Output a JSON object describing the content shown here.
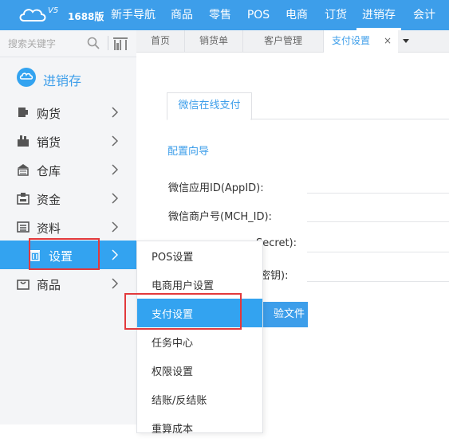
{
  "topbar": {
    "logo_superscript": "V5",
    "logo_version": "1688版",
    "nav": [
      {
        "label": "新手导航",
        "active": false
      },
      {
        "label": "商品",
        "active": false
      },
      {
        "label": "零售",
        "active": false
      },
      {
        "label": "POS",
        "active": false
      },
      {
        "label": "电商",
        "active": false
      },
      {
        "label": "订货",
        "active": false
      },
      {
        "label": "进销存",
        "active": true
      },
      {
        "label": "会计",
        "active": false
      }
    ]
  },
  "sidebar": {
    "search_placeholder": "搜索关键字",
    "module_label": "进销存",
    "items": [
      {
        "label": "购货",
        "icon": "cart-icon"
      },
      {
        "label": "销货",
        "icon": "sales-icon"
      },
      {
        "label": "仓库",
        "icon": "warehouse-icon"
      },
      {
        "label": "资金",
        "icon": "fund-icon"
      },
      {
        "label": "资料",
        "icon": "data-icon"
      },
      {
        "label": "设置",
        "icon": "trash-icon",
        "active": true
      },
      {
        "label": "商品",
        "icon": "bag-icon"
      }
    ]
  },
  "tabs": [
    {
      "label": "首页",
      "active": false
    },
    {
      "label": "销货单",
      "active": false
    },
    {
      "label": "客户管理",
      "active": false
    },
    {
      "label": "支付设置",
      "active": true,
      "close": "×"
    }
  ],
  "content": {
    "subtab": "微信在线支付",
    "config_link": "配置向导",
    "fields": [
      "微信应用ID(AppID):",
      "微信商户号(MCH_ID):",
      "Secret):",
      "密钥):"
    ],
    "upload_button_partial": "验文件"
  },
  "dropdown": {
    "items": [
      {
        "label": "POS设置"
      },
      {
        "label": "电商用户设置"
      },
      {
        "label": "支付设置",
        "active": true
      },
      {
        "label": "任务中心"
      },
      {
        "label": "权限设置"
      },
      {
        "label": "结账/反结账"
      },
      {
        "label": "重算成本"
      }
    ]
  },
  "colors": {
    "primary": "#3d9eea",
    "highlight": "#33a3f0",
    "annotation_red": "#e2393c"
  }
}
